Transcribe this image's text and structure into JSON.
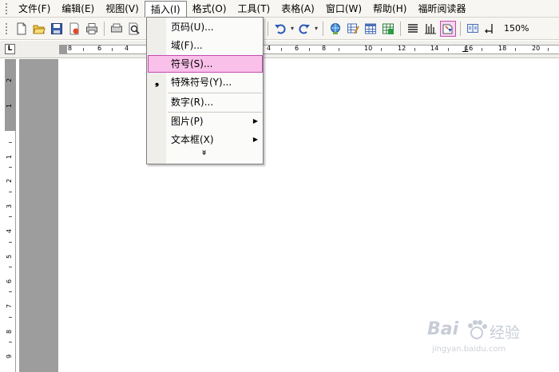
{
  "menubar": {
    "items": [
      {
        "label": "文件(F)"
      },
      {
        "label": "编辑(E)"
      },
      {
        "label": "视图(V)"
      },
      {
        "label": "插入(I)"
      },
      {
        "label": "格式(O)"
      },
      {
        "label": "工具(T)"
      },
      {
        "label": "表格(A)"
      },
      {
        "label": "窗口(W)"
      },
      {
        "label": "帮助(H)"
      },
      {
        "label": "福昕阅读器"
      }
    ],
    "active_index": 3
  },
  "toolbar": {
    "zoom": "150%",
    "icons": [
      "new-doc-icon",
      "open-folder-icon",
      "save-icon",
      "permission-icon",
      "print-preview-icon",
      "print-icon",
      "search-icon",
      "undo-icon",
      "redo-icon",
      "hyperlink-icon",
      "tables-borders-icon",
      "insert-table-icon",
      "insert-excel-icon",
      "columns-icon",
      "drawing-icon",
      "document-map-icon",
      "reading-icon",
      "show-formatting-icon"
    ]
  },
  "ruler": {
    "tab_selector": "L",
    "h_numbers": [
      "8",
      "6",
      "4",
      "4",
      "6",
      "8",
      "10",
      "12",
      "14",
      "16",
      "18",
      "20"
    ],
    "v_numbers": [
      "2",
      "1",
      "1",
      "2",
      "3",
      "4",
      "5",
      "6",
      "7",
      "8",
      "9"
    ]
  },
  "insert_menu": {
    "items": [
      {
        "label": "页码(U)..."
      },
      {
        "label": "域(F)..."
      },
      {
        "label": "符号(S)..."
      },
      {
        "label": "特殊符号(Y)..."
      },
      {
        "label": "数字(R)..."
      },
      {
        "label": "图片(P)"
      },
      {
        "label": "文本框(X)"
      }
    ],
    "highlighted_index": 2,
    "expand_glyph": "»"
  },
  "watermark": {
    "brand": "Bai",
    "brand_cn": "经验",
    "url": "jingyan.baidu.com"
  },
  "colors": {
    "highlight": "#f9c0e9",
    "highlight_border": "#c44bb0",
    "bar_bg": "#f7f6f3",
    "page_gap": "#9d9d9d"
  }
}
